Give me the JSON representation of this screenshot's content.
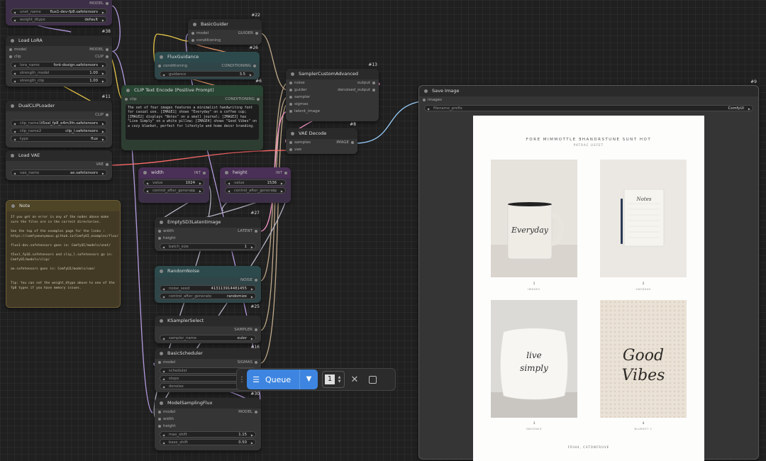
{
  "nodes": {
    "unet": {
      "outputs": [
        "MODEL"
      ],
      "widgets": [
        {
          "label": "unet_name",
          "value": "flux1-dev-fp8.safetensors"
        },
        {
          "label": "weight_dtype",
          "value": "default"
        }
      ]
    },
    "lora": {
      "id": "#38",
      "title": "Load LoRA",
      "inputs": [
        "model",
        "clip"
      ],
      "outputs": [
        "MODEL",
        "CLIP"
      ],
      "widgets": [
        {
          "label": "lora_name",
          "value": "font-design.safetensors"
        },
        {
          "label": "strength_model",
          "value": "1.00"
        },
        {
          "label": "strength_clip",
          "value": "1.00"
        }
      ]
    },
    "dualclip": {
      "id": "#11",
      "title": "DualCLIPLoader",
      "outputs": [
        "CLIP"
      ],
      "widgets": [
        {
          "label": "clip_name1",
          "value": "t5xxl_fp8_e4m3fn.safetensors"
        },
        {
          "label": "clip_name2",
          "value": "clip_l.safetensors"
        },
        {
          "label": "type",
          "value": "flux"
        }
      ]
    },
    "vae": {
      "title": "Load VAE",
      "outputs": [
        "VAE"
      ],
      "widgets": [
        {
          "label": "vae_name",
          "value": "ae.safetensors"
        }
      ]
    },
    "note": {
      "title": "Note",
      "text": "If you get an error in any of the nodes above make sure the files are in the correct directories.\n\nSee the top of the examples page for the links : https://comfyanonymous.github.io/ComfyUI_examples/flux/\n\nflux1-dev.safetensors goes in: ComfyUI/models/unet/\n\nt5xxl_fp16.safetensors and clip_l.safetensors go in: ComfyUI/models/clip/\n\nae.safetensors goes in: ComfyUI/models/vae/\n\n\nTip: You can set the weight_dtype above to one of the fp8 types if you have memory issues."
    },
    "guider": {
      "id": "#22",
      "title": "BasicGuider",
      "inputs": [
        "model",
        "conditioning"
      ],
      "outputs": [
        "GUIDER"
      ]
    },
    "fluxguidance": {
      "id": "#26",
      "title": "FluxGuidance",
      "inputs": [
        "conditioning"
      ],
      "outputs": [
        "CONDITIONING"
      ],
      "widgets": [
        {
          "label": "guidance",
          "value": "3.5"
        }
      ]
    },
    "cliptext": {
      "id": "#6",
      "title": "CLIP Text Encode (Positive Prompt)",
      "inputs": [
        "clip"
      ],
      "outputs": [
        "CONDITIONING"
      ],
      "text": "The set of four images features a minimalist handwriting font for casual use. [IMAGE1] shows \"Everyday\" on a coffee cup; [IMAGE2] displays \"Notes\" on a small journal; [IMAGE3] has \"Live Simply\" on a white pillow; [IMAGE4] shows \"Good Vibes\" on a cozy blanket, perfect for lifestyle and home decor branding."
    },
    "sampler_adv": {
      "id": "#13",
      "title": "SamplerCustomAdvanced",
      "inputs": [
        "noise",
        "guider",
        "sampler",
        "sigmas",
        "latent_image"
      ],
      "outputs": [
        "output",
        "denoised_output"
      ]
    },
    "vaedecode": {
      "id": "#8",
      "title": "VAE Decode",
      "inputs": [
        "samples",
        "vae"
      ],
      "outputs": [
        "IMAGE"
      ]
    },
    "width": {
      "title": "width",
      "outputs": [
        "INT"
      ],
      "widgets": [
        {
          "label": "value",
          "value": "1024"
        },
        {
          "label": "control_after_generate",
          "value": "..."
        }
      ]
    },
    "height": {
      "title": "height",
      "outputs": [
        "INT"
      ],
      "widgets": [
        {
          "label": "value",
          "value": "1536"
        },
        {
          "label": "control_after_generate",
          "value": "..."
        }
      ]
    },
    "latent": {
      "id": "#27",
      "title": "EmptySD3LatentImage",
      "inputs": [
        "width",
        "height"
      ],
      "outputs": [
        "LATENT"
      ],
      "widgets": [
        {
          "label": "batch_size",
          "value": "1"
        }
      ]
    },
    "noise": {
      "id": "#25",
      "title": "RandomNoise",
      "outputs": [
        "NOISE"
      ],
      "widgets": [
        {
          "label": "noise_seed",
          "value": "413113914481455"
        },
        {
          "label": "control_after_generate",
          "value": "randomize"
        }
      ]
    },
    "ksel": {
      "id": "#16",
      "title": "KSamplerSelect",
      "outputs": [
        "SAMPLER"
      ],
      "widgets": [
        {
          "label": "sampler_name",
          "value": "euler"
        }
      ]
    },
    "scheduler": {
      "id": "#17",
      "title": "BasicScheduler",
      "inputs": [
        "model"
      ],
      "outputs": [
        "SIGMAS"
      ],
      "widgets": [
        {
          "label": "scheduler",
          "value": "si"
        },
        {
          "label": "steps",
          "value": ""
        },
        {
          "label": "denoise",
          "value": ""
        }
      ]
    },
    "msflux": {
      "id": "#30",
      "title": "ModelSamplingFlux",
      "inputs": [
        "model",
        "width",
        "height"
      ],
      "outputs": [
        "MODEL"
      ],
      "widgets": [
        {
          "label": "max_shift",
          "value": "1.15"
        },
        {
          "label": "base_shift",
          "value": "0.50"
        }
      ]
    },
    "save": {
      "id": "#9",
      "title": "Save Image",
      "inputs": [
        "images"
      ],
      "widgets": [
        {
          "label": "filename_prefix",
          "value": "ComfyUI"
        }
      ]
    }
  },
  "preview": {
    "header": "FORE MIMMOTTLE ƎHANDRSTUNE SUNT HOT",
    "subheader": "PATRAC USFET",
    "cards": [
      {
        "num": "1",
        "caption": "IMAGE2",
        "script": "Everyday"
      },
      {
        "num": "2",
        "caption": "1NOD5AV",
        "script": "Notes"
      },
      {
        "num": "3",
        "caption": "ONIZSNIZ",
        "script": "live simply"
      },
      {
        "num": "4",
        "caption": "BLURKET 2",
        "script": "Good Vibes"
      }
    ],
    "footer": "FRIH4, CATONFRUVE"
  },
  "queue": {
    "label": "Queue",
    "count": "1",
    "icon": "queue-list-icon"
  },
  "colors": {
    "accent": "#3d85e0",
    "wire_model": "#b49be0",
    "wire_clip": "#e8c84a",
    "wire_vae": "#ff6b6b",
    "wire_cond": "#f0a070",
    "wire_latent": "#ff9ccf",
    "wire_int": "#b8b8c8"
  }
}
